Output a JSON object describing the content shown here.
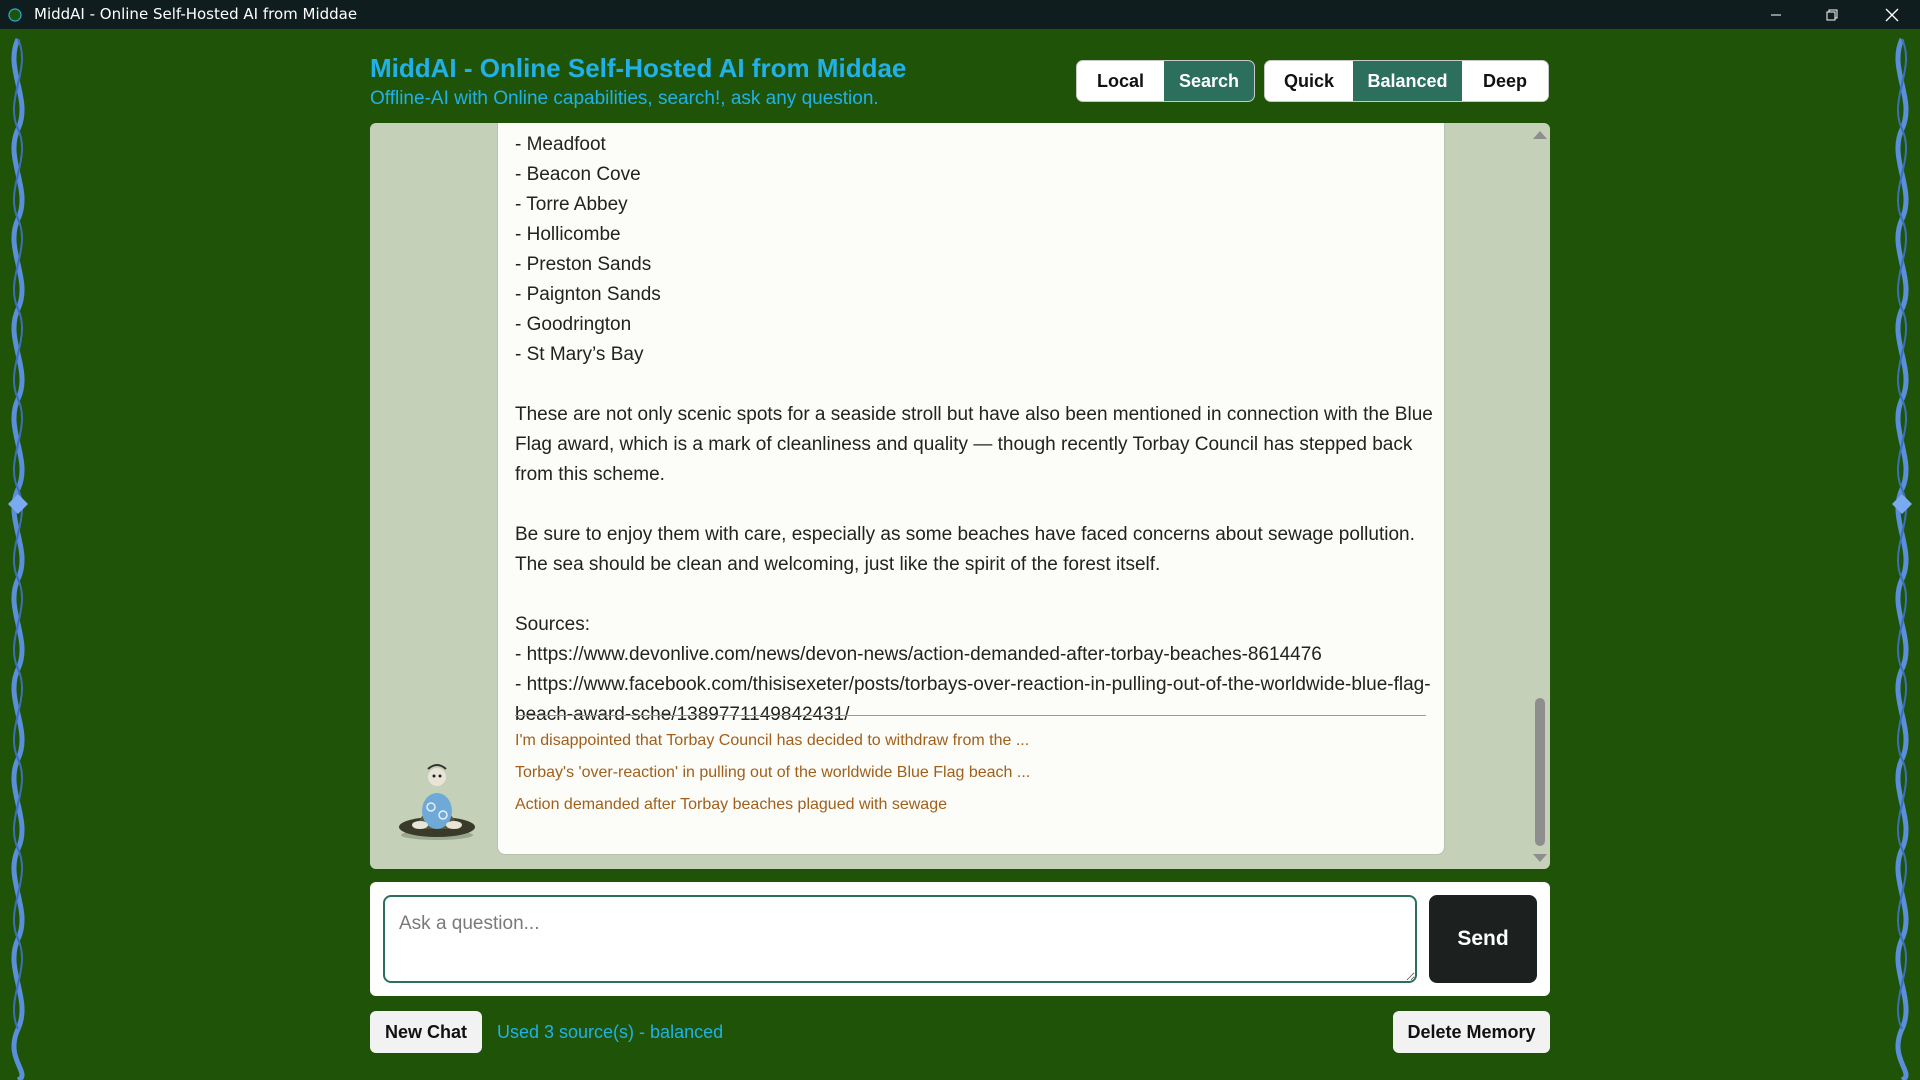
{
  "window": {
    "title": "MiddAI - Online Self-Hosted AI from Middae"
  },
  "header": {
    "title": "MiddAI - Online Self-Hosted AI from Middae",
    "subtitle": "Offline-AI with Online capabilities, search!, ask any question."
  },
  "source_toggle": [
    {
      "label": "Local",
      "active": false
    },
    {
      "label": "Search",
      "active": true
    }
  ],
  "depth_toggle": [
    {
      "label": "Quick",
      "active": false
    },
    {
      "label": "Balanced",
      "active": true
    },
    {
      "label": "Deep",
      "active": false
    }
  ],
  "message": {
    "lines": [
      "- Meadfoot",
      "- Beacon Cove",
      "- Torre Abbey",
      "- Hollicombe",
      "- Preston Sands",
      "- Paignton Sands",
      "- Goodrington",
      "- St Mary’s Bay",
      "",
      "These are not only scenic spots for a seaside stroll but have also been mentioned in connection with the Blue Flag award, which is a mark of cleanliness and quality — though recently Torbay Council has stepped back from this scheme.",
      "",
      "Be sure to enjoy them with care, especially as some beaches have faced concerns about sewage pollution. The sea should be clean and welcoming, just like the spirit of the forest itself.",
      "",
      "Sources:",
      "- https://www.devonlive.com/news/devon-news/action-demanded-after-torbay-beaches-8614476",
      "- https://www.facebook.com/thisisexeter/posts/torbays-over-reaction-in-pulling-out-of-the-worldwide-blue-flag-beach-award-sche/1389771149842431/"
    ],
    "source_links": [
      "I'm disappointed that Torbay Council has decided to withdraw from the ...",
      "Torbay's 'over-reaction' in pulling out of the worldwide Blue Flag beach ...",
      "Action demanded after Torbay beaches plagued with sewage"
    ]
  },
  "scroll": {
    "position_fraction": 0.92
  },
  "input": {
    "placeholder": "Ask a question...",
    "value": "",
    "send_label": "Send"
  },
  "footer": {
    "new_chat_label": "New Chat",
    "status": "Used 3 source(s) - balanced",
    "delete_memory_label": "Delete Memory"
  },
  "colors": {
    "background": "#1f5408",
    "accent_blue": "#22b0e8",
    "active_toggle": "#2d6f5d",
    "chat_panel": "#c4d0b7",
    "source_link": "#a0601c",
    "send_button": "#1c2120",
    "titlebar": "#0f1d1f"
  },
  "icons": {
    "app": "app-icon",
    "minimize": "minimize-icon",
    "maximize": "restore-icon",
    "close": "close-icon",
    "avatar": "meditating-figure-avatar"
  }
}
